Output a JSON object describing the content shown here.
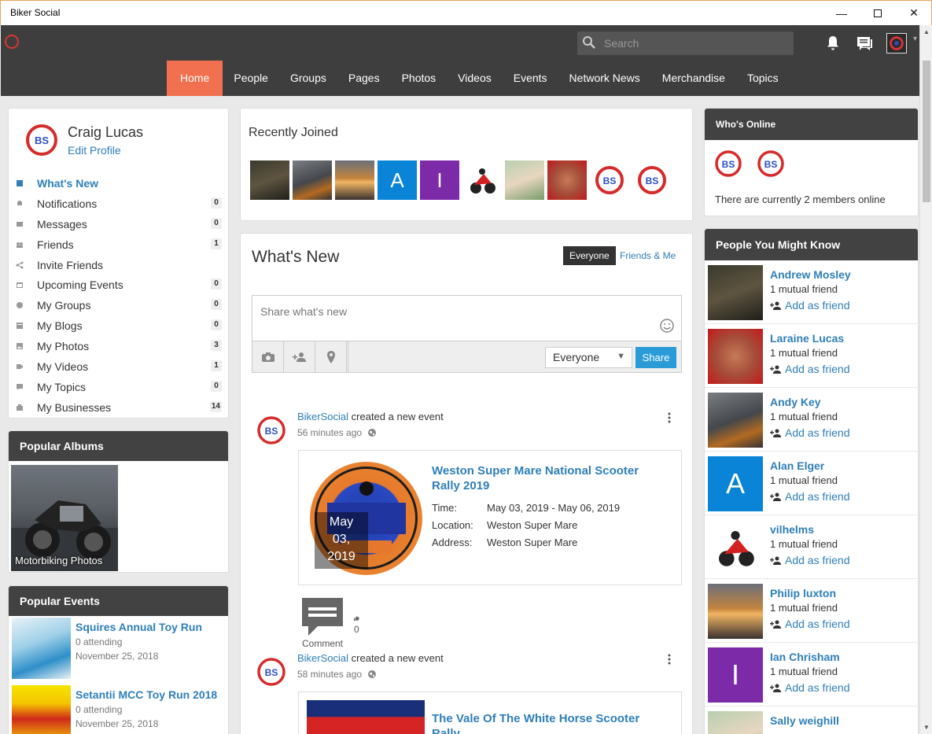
{
  "window": {
    "title": "Biker Social"
  },
  "search": {
    "placeholder": "Search"
  },
  "nav": [
    "Home",
    "People",
    "Groups",
    "Pages",
    "Photos",
    "Videos",
    "Events",
    "Network News",
    "Merchandise",
    "Topics"
  ],
  "nav_active": "Home",
  "profile": {
    "name": "Craig Lucas",
    "edit_label": "Edit Profile"
  },
  "menu": [
    {
      "label": "What's New",
      "icon": "activity-icon",
      "count": ""
    },
    {
      "label": "Notifications",
      "icon": "bell-icon",
      "count": "0"
    },
    {
      "label": "Messages",
      "icon": "envelope-icon",
      "count": "0"
    },
    {
      "label": "Friends",
      "icon": "friends-icon",
      "count": "1"
    },
    {
      "label": "Invite Friends",
      "icon": "share-icon",
      "count": ""
    },
    {
      "label": "Upcoming Events",
      "icon": "calendar-icon",
      "count": "0"
    },
    {
      "label": "My Groups",
      "icon": "groups-icon",
      "count": "0"
    },
    {
      "label": "My Blogs",
      "icon": "blog-icon",
      "count": "0"
    },
    {
      "label": "My Photos",
      "icon": "photo-icon",
      "count": "3"
    },
    {
      "label": "My Videos",
      "icon": "video-icon",
      "count": "1"
    },
    {
      "label": "My Topics",
      "icon": "topic-icon",
      "count": "0"
    },
    {
      "label": "My Businesses",
      "icon": "business-icon",
      "count": "14"
    }
  ],
  "popular_albums": {
    "title": "Popular Albums",
    "album_label": "Motorbiking Photos"
  },
  "popular_events": {
    "title": "Popular Events",
    "items": [
      {
        "title": "Squires Annual Toy Run",
        "attending": "0 attending",
        "date": "November 25, 2018"
      },
      {
        "title": "Setantii MCC Toy Run 2018",
        "attending": "0 attending",
        "date": "November 25, 2018"
      }
    ]
  },
  "recently_joined": {
    "title": "Recently Joined",
    "letters": [
      "A",
      "I"
    ]
  },
  "whats_new": {
    "title": "What's New",
    "filter_everyone": "Everyone",
    "filter_friends": "Friends & Me",
    "composer_placeholder": "Share what's new",
    "privacy_value": "Everyone",
    "share_label": "Share"
  },
  "posts": [
    {
      "author": "BikerSocial",
      "action": "created a new event",
      "time": "56 minutes ago",
      "event_title": "Weston Super Mare National Scooter Rally 2019",
      "date_badge": [
        "May",
        "03,",
        "2019"
      ],
      "time_label": "Time:",
      "time_value": "May 03, 2019 - May 06, 2019",
      "location_label": "Location:",
      "location_value": "Weston Super Mare",
      "address_label": "Address:",
      "address_value": "Weston Super Mare",
      "comment_label": "Comment",
      "likes": "0"
    },
    {
      "author": "BikerSocial",
      "action": "created a new event",
      "time": "58 minutes ago",
      "event_title": "The Vale Of The White Horse Scooter Rally"
    }
  ],
  "whos_online": {
    "title": "Who's Online",
    "text": "There are currently 2 members online"
  },
  "pymk": {
    "title": "People You Might Know",
    "add_label": "Add as friend",
    "items": [
      {
        "name": "Andrew Mosley",
        "mutual": "1 mutual friend",
        "letter": ""
      },
      {
        "name": "Laraine Lucas",
        "mutual": "1 mutual friend",
        "letter": ""
      },
      {
        "name": "Andy Key",
        "mutual": "1 mutual friend",
        "letter": ""
      },
      {
        "name": "Alan Elger",
        "mutual": "1 mutual friend",
        "letter": "A"
      },
      {
        "name": "vilhelms",
        "mutual": "1 mutual friend",
        "letter": ""
      },
      {
        "name": "Philip luxton",
        "mutual": "1 mutual friend",
        "letter": ""
      },
      {
        "name": "Ian Chrisham",
        "mutual": "1 mutual friend",
        "letter": "I"
      },
      {
        "name": "Sally weighill",
        "mutual": "",
        "letter": ""
      }
    ]
  },
  "colors": {
    "accent": "#f0704f",
    "link": "#2f7fb8",
    "topbar": "#3e3e3e",
    "share": "#2a9bd6",
    "avatar_blue": "#0a84d6",
    "avatar_purple": "#7d2aa8"
  }
}
